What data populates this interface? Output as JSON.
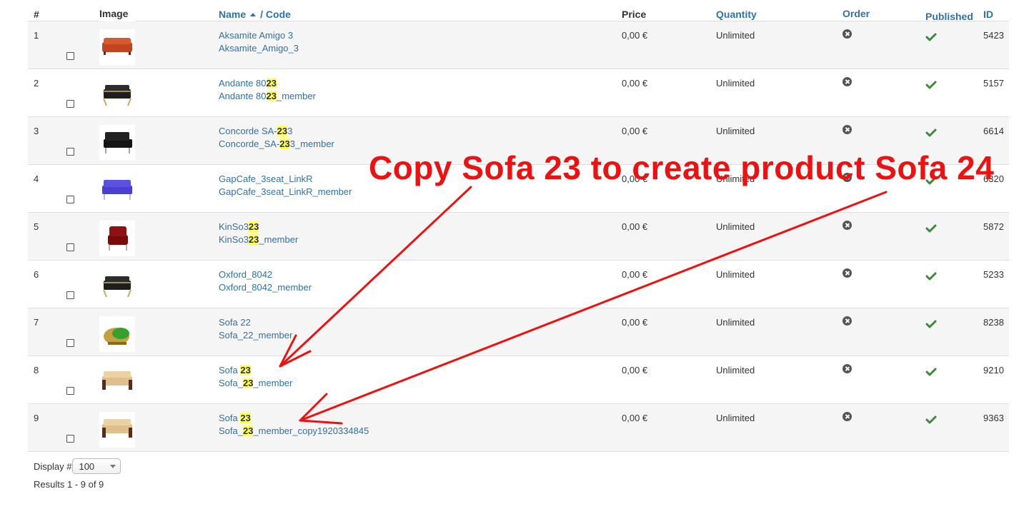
{
  "columns": {
    "num": "#",
    "image": "Image",
    "name": "Name",
    "code": "/ Code",
    "price": "Price",
    "quantity": "Quantity",
    "order": "Order",
    "published": "Published",
    "id": "ID"
  },
  "rows": [
    {
      "num": "1",
      "name": [
        {
          "t": "Aksamite Amigo 3"
        }
      ],
      "code": [
        {
          "t": "Aksamite_Amigo_3"
        }
      ],
      "price": "0,00 €",
      "quantity": "Unlimited",
      "id": "5423",
      "thumb": "sofa-orange"
    },
    {
      "num": "2",
      "name": [
        {
          "t": "Andante 80"
        },
        {
          "t": "23",
          "h": 1
        }
      ],
      "code": [
        {
          "t": "Andante 80"
        },
        {
          "t": "23",
          "h": 1
        },
        {
          "t": "_member"
        }
      ],
      "price": "0,00 €",
      "quantity": "Unlimited",
      "id": "5157",
      "thumb": "sofa-black-wood"
    },
    {
      "num": "3",
      "name": [
        {
          "t": "Concorde SA-"
        },
        {
          "t": "23",
          "h": 1
        },
        {
          "t": "3"
        }
      ],
      "code": [
        {
          "t": "Concorde_SA-"
        },
        {
          "t": "23",
          "h": 1
        },
        {
          "t": "3_member"
        }
      ],
      "price": "0,00 €",
      "quantity": "Unlimited",
      "id": "6614",
      "thumb": "sofa-black"
    },
    {
      "num": "4",
      "name": [
        {
          "t": "GapCafe_3seat_LinkR"
        }
      ],
      "code": [
        {
          "t": "GapCafe_3seat_LinkR_member"
        }
      ],
      "price": "0,00 €",
      "quantity": "Unlimited",
      "id": "6320",
      "thumb": "sofa-purple"
    },
    {
      "num": "5",
      "name": [
        {
          "t": "KinSo3"
        },
        {
          "t": "23",
          "h": 1
        }
      ],
      "code": [
        {
          "t": "KinSo3"
        },
        {
          "t": "23",
          "h": 1
        },
        {
          "t": "_member"
        }
      ],
      "price": "0,00 €",
      "quantity": "Unlimited",
      "id": "5872",
      "thumb": "chair-red"
    },
    {
      "num": "6",
      "name": [
        {
          "t": "Oxford_8042"
        }
      ],
      "code": [
        {
          "t": "Oxford_8042_member"
        }
      ],
      "price": "0,00 €",
      "quantity": "Unlimited",
      "id": "5233",
      "thumb": "sofa-black-wood"
    },
    {
      "num": "7",
      "name": [
        {
          "t": "Sofa 22"
        }
      ],
      "code": [
        {
          "t": "Sofa_22_member"
        }
      ],
      "price": "0,00 €",
      "quantity": "Unlimited",
      "id": "8238",
      "thumb": "chair-green"
    },
    {
      "num": "8",
      "name": [
        {
          "t": "Sofa "
        },
        {
          "t": "23",
          "h": 1
        }
      ],
      "code": [
        {
          "t": "Sofa_"
        },
        {
          "t": "23",
          "h": 1
        },
        {
          "t": "_member"
        }
      ],
      "price": "0,00 €",
      "quantity": "Unlimited",
      "id": "9210",
      "thumb": "sofa-beige"
    },
    {
      "num": "9",
      "name": [
        {
          "t": "Sofa "
        },
        {
          "t": "23",
          "h": 1
        }
      ],
      "code": [
        {
          "t": "Sofa_"
        },
        {
          "t": "23",
          "h": 1
        },
        {
          "t": "_member_copy1920334845"
        }
      ],
      "price": "0,00 €",
      "quantity": "Unlimited",
      "id": "9363",
      "thumb": "sofa-beige"
    }
  ],
  "icons": {
    "order": "x-circle-icon",
    "published": "check-icon",
    "sort": "sort-ascending-icon"
  },
  "colors": {
    "link": "#3071a9",
    "highlight": "#ffff66",
    "annotation": "#ee1111",
    "published": "#3a8a3a",
    "order_icon": "#555555"
  },
  "footer": {
    "display_label": "Display #",
    "display_value": "100",
    "results": "Results 1 - 9 of 9"
  },
  "annotation": {
    "text": "Copy Sofa 23 to create product Sofa 24"
  }
}
